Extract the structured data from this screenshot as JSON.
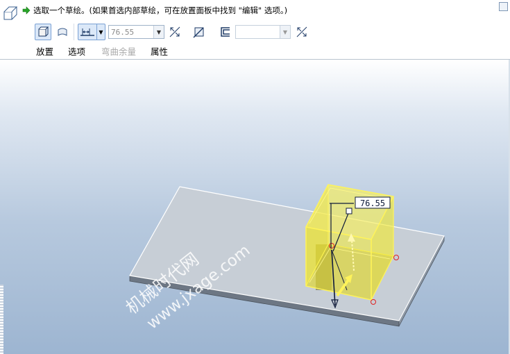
{
  "prompt": {
    "message": "选取一个草绘。(如果首选内部草绘，可在放置面板中找到 \"编辑\" 选项。)"
  },
  "toolbar": {
    "depth_value": "76.55",
    "icons": [
      "solid-extrude-icon",
      "surface-extrude-icon",
      "depth-blind-icon",
      "flip-direction-icon",
      "remove-material-icon",
      "thicken-icon",
      "flip-thicken-icon"
    ]
  },
  "tabs": [
    {
      "label": "放置",
      "enabled": true
    },
    {
      "label": "选项",
      "enabled": true
    },
    {
      "label": "弯曲余量",
      "enabled": false
    },
    {
      "label": "属性",
      "enabled": true
    }
  ],
  "viewport": {
    "dimension_label": "76.55",
    "watermark_line1": "机械时代网",
    "watermark_line2": "www.jxage.com"
  },
  "colors": {
    "feature_preview": "#ffff33",
    "plate_top": "#c8cfd6",
    "background_top": "#ffffff",
    "background_bottom": "#9db5d1"
  }
}
